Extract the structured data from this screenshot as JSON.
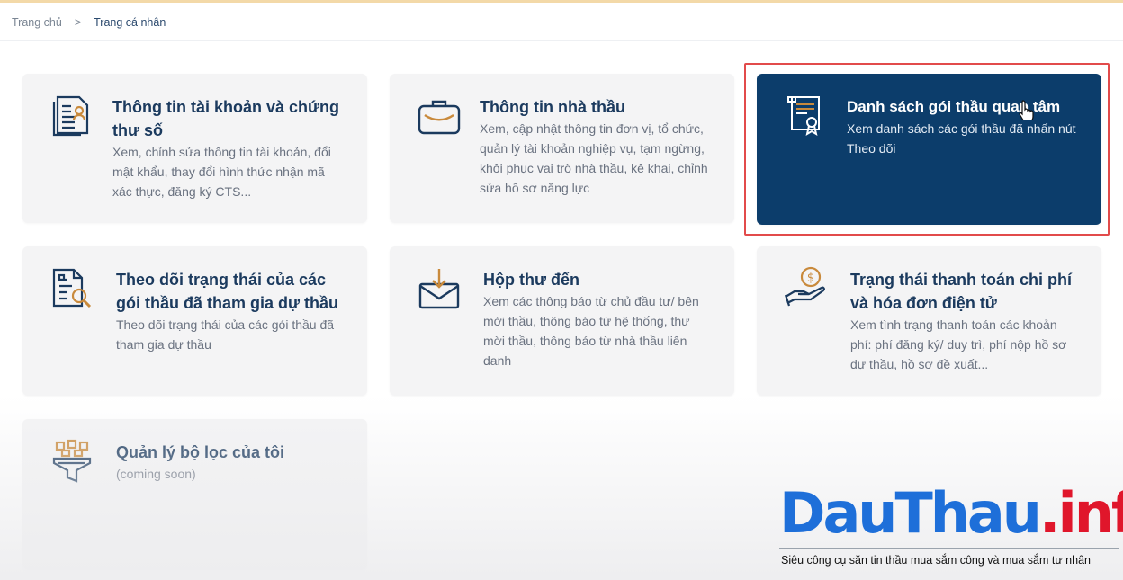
{
  "breadcrumb": {
    "home": "Trang chủ",
    "separator": ">",
    "current": "Trang cá nhân"
  },
  "cards": [
    {
      "title": "Thông tin tài khoản và chứng thư số",
      "desc": "Xem, chỉnh sửa thông tin tài khoản, đổi mật khẩu, thay đổi hình thức nhận mã xác thực, đăng ký CTS...",
      "icon": "account-document-icon",
      "active": false
    },
    {
      "title": "Thông tin nhà thầu",
      "desc": "Xem, cập nhật thông tin đơn vị, tổ chức, quản lý tài khoản nghiệp vụ, tạm ngừng, khôi phục vai trò nhà thầu, kê khai, chỉnh sửa hồ sơ năng lực",
      "icon": "briefcase-icon",
      "active": false
    },
    {
      "title": "Danh sách gói thầu quan tâm",
      "desc": "Xem danh sách các gói thầu đã nhấn nút Theo dõi",
      "icon": "certificate-icon",
      "active": true
    },
    {
      "title": "Theo dõi trạng thái của các gói thầu đã tham gia dự thầu",
      "desc": "Theo dõi trạng thái của các gói thầu đã tham gia dự thầu",
      "icon": "document-search-icon",
      "active": false
    },
    {
      "title": "Hộp thư đến",
      "desc": "Xem các thông báo từ chủ đầu tư/ bên mời thầu, thông báo từ hệ thống, thư mời thầu, thông báo từ nhà thầu liên danh",
      "icon": "inbox-icon",
      "active": false
    },
    {
      "title": "Trạng thái thanh toán chi phí và hóa đơn điện tử",
      "desc": "Xem tình trạng thanh toán các khoản phí: phí đăng ký/ duy trì, phí nộp hồ sơ dự thầu, hồ sơ đề xuất...",
      "icon": "payment-hand-icon",
      "active": false
    },
    {
      "title": "Quản lý bộ lọc của tôi",
      "desc": "(coming soon)",
      "icon": "filter-icon",
      "active": false
    }
  ],
  "logo": {
    "part1": "Dau",
    "part2": "Thau",
    "part3": ".",
    "part4": "info",
    "tagline": "Siêu công cụ săn tin thầu mua sắm công và mua sắm tư nhân"
  },
  "colors": {
    "navy": "#0c3d6b",
    "card_bg": "#f4f4f5",
    "icon_blue": "#1b3a5e",
    "icon_accent": "#c98a3c",
    "highlight_red": "#e24b4b",
    "logo_blue": "#1e6fd9",
    "logo_red": "#e0162b"
  }
}
